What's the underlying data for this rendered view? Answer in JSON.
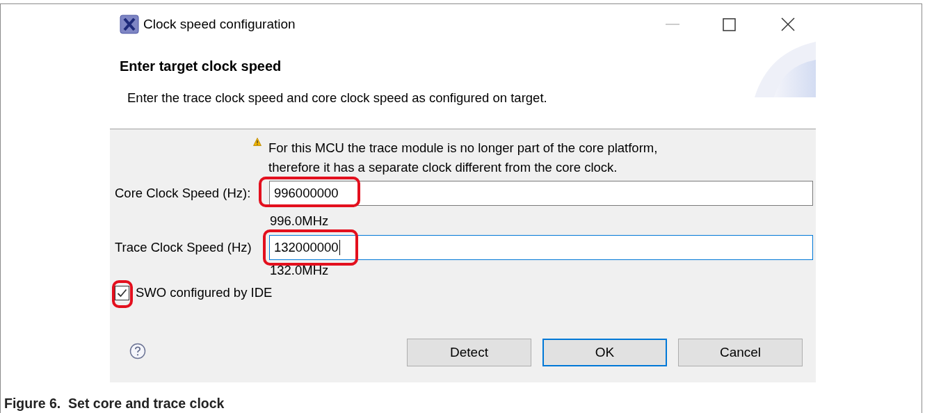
{
  "window": {
    "title": "Clock speed configuration"
  },
  "header": {
    "title": "Enter target clock speed",
    "description": "Enter the trace clock speed and core clock speed as configured on target."
  },
  "warning": {
    "text": "For this MCU the trace module is no longer part of the core platform,\ntherefore it has a separate clock different from the core clock."
  },
  "fields": [
    {
      "label": "Core Clock Speed (Hz):",
      "value": "996000000",
      "hint": "996.0MHz",
      "focused": false,
      "highlighted": true
    },
    {
      "label": "Trace Clock Speed (Hz)",
      "value": "132000000",
      "hint": "132.0MHz",
      "focused": true,
      "highlighted": true
    }
  ],
  "checkbox": {
    "label": "SWO configured by IDE",
    "checked": true,
    "highlighted": true
  },
  "buttons": [
    {
      "label": "Detect",
      "default": false
    },
    {
      "label": "OK",
      "default": true
    },
    {
      "label": "Cancel",
      "default": false
    }
  ],
  "caption": "Figure 6.  Set core and trace clock"
}
